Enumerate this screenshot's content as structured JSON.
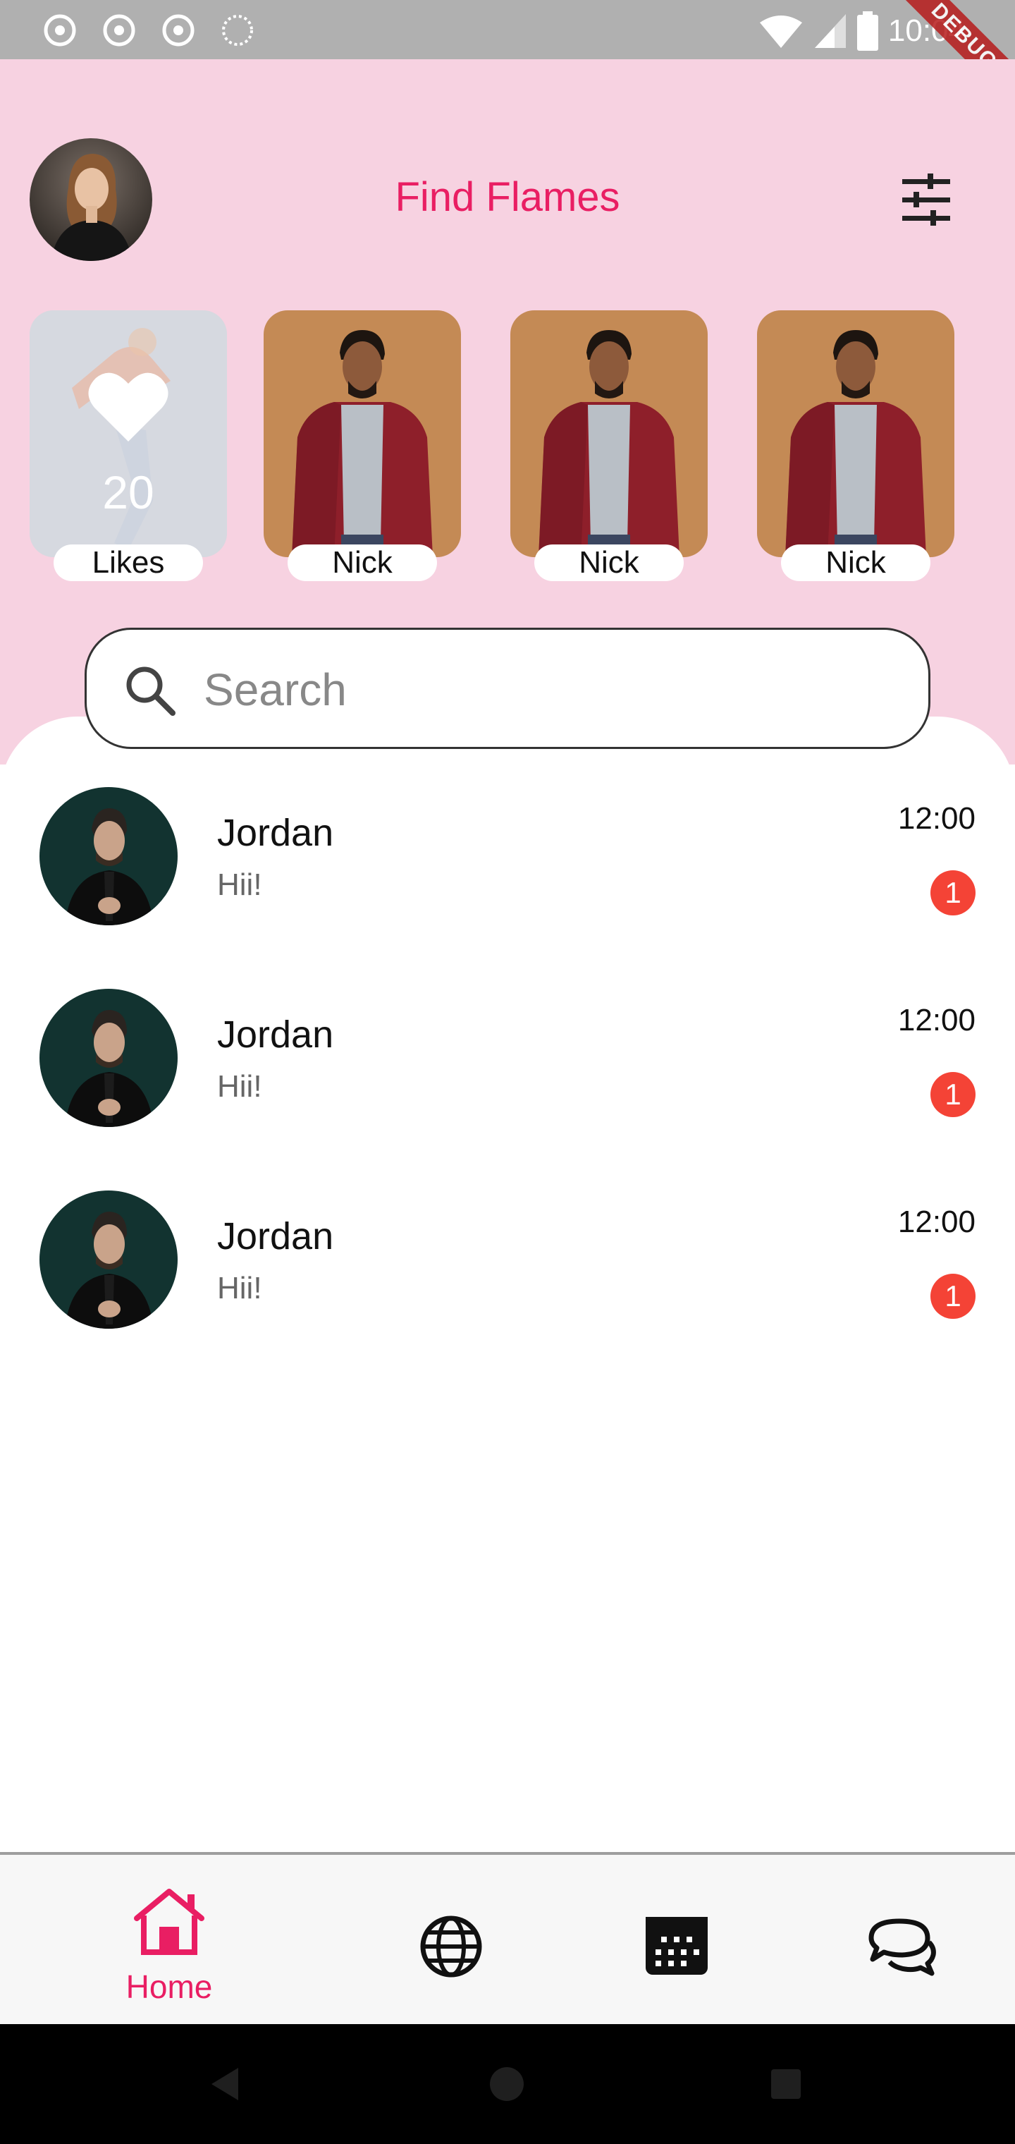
{
  "status_bar": {
    "time": "10:04",
    "debug_banner": "DEBUG",
    "notification_icons": [
      "chrome-icon",
      "chrome-icon",
      "chrome-icon",
      "loading-icon"
    ],
    "right_icons": [
      "wifi-icon",
      "signal-icon",
      "battery-icon"
    ]
  },
  "header": {
    "title": "Find Flames",
    "filter_icon": "tune-icon",
    "avatar": "profile-avatar"
  },
  "stories": [
    {
      "label": "Likes",
      "count": "20",
      "icon": "heart-icon"
    },
    {
      "label": "Nick"
    },
    {
      "label": "Nick"
    },
    {
      "label": "Nick"
    }
  ],
  "search": {
    "placeholder": "Search",
    "icon": "search-icon"
  },
  "chats": [
    {
      "name": "Jordan",
      "message": "Hii!",
      "time": "12:00",
      "unread": "1"
    },
    {
      "name": "Jordan",
      "message": "Hii!",
      "time": "12:00",
      "unread": "1"
    },
    {
      "name": "Jordan",
      "message": "Hii!",
      "time": "12:00",
      "unread": "1"
    }
  ],
  "bottom_nav": {
    "items": [
      {
        "label": "Home",
        "icon": "home-icon",
        "active": true
      },
      {
        "label": "",
        "icon": "globe-icon",
        "active": false
      },
      {
        "label": "",
        "icon": "calendar-icon",
        "active": false
      },
      {
        "label": "",
        "icon": "chat-bubbles-icon",
        "active": false
      }
    ]
  },
  "colors": {
    "accent": "#e91e63",
    "header_bg": "#f7d2e1",
    "badge": "#f44336",
    "story_bg": "#c48a55"
  }
}
